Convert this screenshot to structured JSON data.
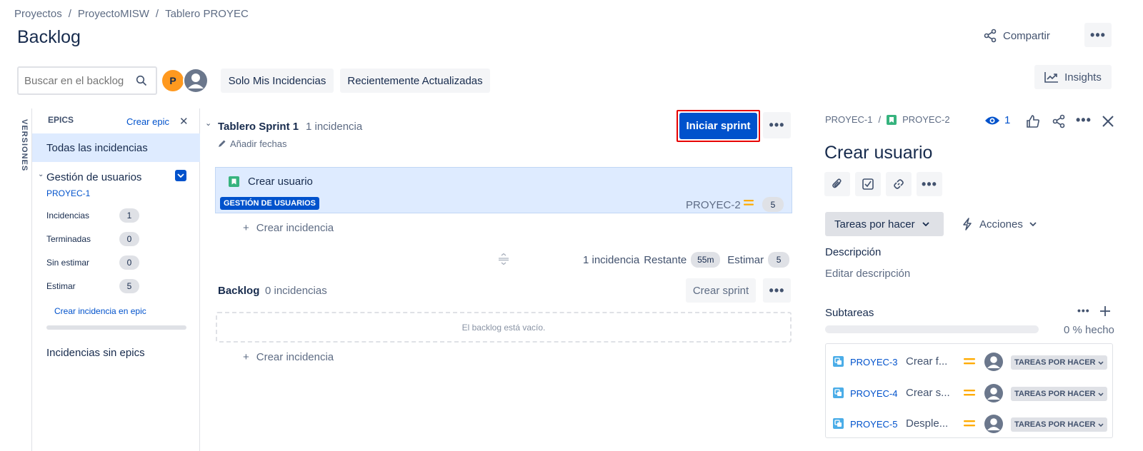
{
  "breadcrumb": [
    "Proyectos",
    "/",
    "ProyectoMISW",
    "/",
    "Tablero PROYEC"
  ],
  "page_title": "Backlog",
  "header": {
    "share_label": "Compartir",
    "more_label": "•••",
    "insights_label": "Insights"
  },
  "toolbar": {
    "search_placeholder": "Buscar en el backlog",
    "avatar_initial": "P",
    "filter_mine": "Solo Mis Incidencias",
    "filter_recent": "Recientemente Actualizadas"
  },
  "epics_panel": {
    "versions_label": "VERSIONES",
    "title": "EPICS",
    "create_epic": "Crear epic",
    "close": "✕",
    "all_issues": "Todas las incidencias",
    "epic_name": "Gestión de usuarios",
    "epic_key": "PROYEC-1",
    "stats": [
      {
        "label": "Incidencias",
        "value": "1"
      },
      {
        "label": "Terminadas",
        "value": "0"
      },
      {
        "label": "Sin estimar",
        "value": "0"
      },
      {
        "label": "Estimar",
        "value": "5"
      }
    ],
    "create_in_epic": "Crear incidencia en epic",
    "no_epics": "Incidencias sin epics"
  },
  "sprint": {
    "name": "Tablero Sprint 1",
    "count": "1 incidencia",
    "add_dates": "Añadir fechas",
    "start_button": "Iniciar sprint",
    "issue": {
      "title": "Crear usuario",
      "epic_label": "GESTIÓN DE USUARIOS",
      "key": "PROYEC-2",
      "points": "5"
    },
    "create_issue": "Crear incidencia",
    "footer": {
      "count": "1 incidencia",
      "remaining_label": "Restante",
      "remaining_value": "55m",
      "estimate_label": "Estimar",
      "estimate_value": "5"
    }
  },
  "backlog": {
    "name": "Backlog",
    "count": "0 incidencias",
    "create_sprint": "Crear sprint",
    "empty": "El backlog está vacío.",
    "create_issue": "Crear incidencia"
  },
  "detail": {
    "parent_key": "PROYEC-1",
    "sep": "/",
    "key": "PROYEC-2",
    "watch_count": "1",
    "title": "Crear usuario",
    "status": "Tareas por hacer",
    "actions": "Acciones",
    "description_label": "Descripción",
    "description_placeholder": "Editar descripción",
    "subtasks_label": "Subtareas",
    "progress_text": "0 % hecho",
    "progress_fraction": 0,
    "subtasks": [
      {
        "key": "PROYEC-3",
        "title": "Crear f...",
        "status": "TAREAS POR HACER"
      },
      {
        "key": "PROYEC-4",
        "title": "Crear s...",
        "status": "TAREAS POR HACER"
      },
      {
        "key": "PROYEC-5",
        "title": "Desple...",
        "status": "TAREAS POR HACER"
      }
    ]
  },
  "colors": {
    "primary": "#0052cc",
    "highlight_border": "#e60000",
    "selected_bg": "#deebff",
    "story_green": "#36b37e",
    "priority_orange": "#ffab00",
    "avatar_orange": "#ff991f"
  }
}
